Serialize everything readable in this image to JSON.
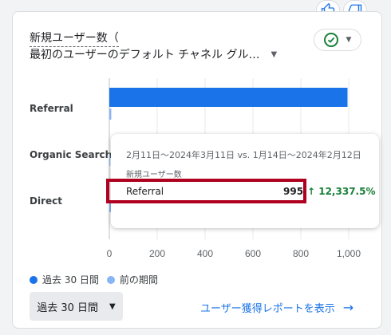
{
  "card": {
    "title_line1": "新規ユーザー数（",
    "title_line2": "最初のユーザーのデフォルト チャネル グル…",
    "dropdown_icon": "▼",
    "status_icon": "check-circle-icon",
    "status_dropdown_icon": "▼"
  },
  "feedback": {
    "thumbs_up_icon": "thumbs-up-icon",
    "thumbs_down_icon": "thumbs-down-icon"
  },
  "chart_data": {
    "type": "bar",
    "orientation": "horizontal",
    "categories": [
      "Referral",
      "Organic Search",
      "Direct"
    ],
    "series": [
      {
        "name": "過去 30 日間",
        "values": [
          995,
          0,
          0
        ],
        "color": "#1a73e8"
      },
      {
        "name": "前の期間",
        "values": [
          8,
          4,
          50
        ],
        "color": "#8ab4f8"
      }
    ],
    "x_ticks": [
      "0",
      "200",
      "400",
      "600",
      "800",
      "1,000"
    ],
    "xlim": [
      0,
      1000
    ],
    "grid": true,
    "legend_position": "bottom-left"
  },
  "tooltip": {
    "date_range": "2月11日～2024年3月11日 vs. 1月14日～2024年2月12日",
    "metric": "新規ユーザー数",
    "row_name": "Referral",
    "row_value": "995",
    "row_change": "↑ 12,337.5%"
  },
  "legend": {
    "current": "過去 30 日間",
    "previous": "前の期間"
  },
  "footer": {
    "period_label": "過去 30 日間",
    "period_dropdown_icon": "▼",
    "report_link": "ユーザー獲得レポートを表示",
    "arrow_icon": "→"
  },
  "colors": {
    "current": "#1a73e8",
    "previous": "#8ab4f8",
    "positive": "#188038",
    "highlight": "#b00020",
    "link": "#1a73e8"
  }
}
